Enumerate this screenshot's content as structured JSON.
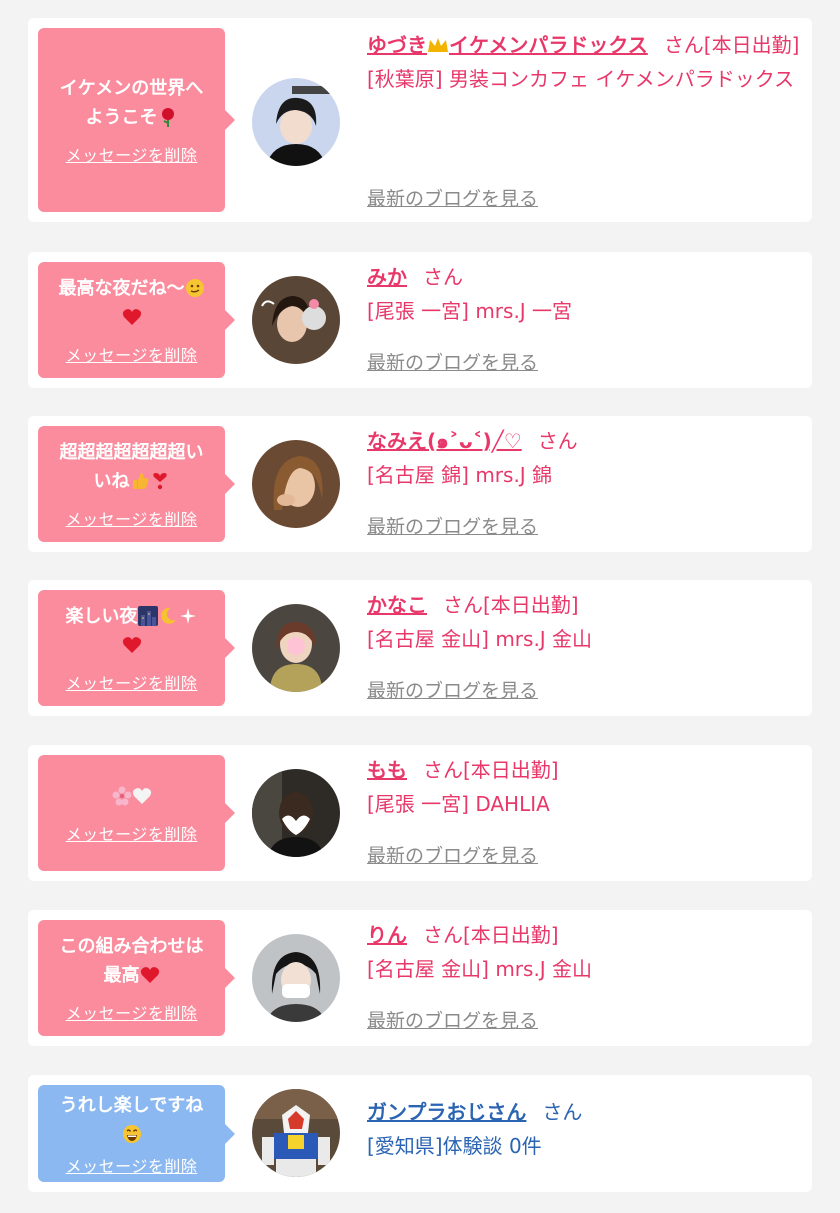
{
  "delete_label": "メッセージを削除",
  "blog_label": "最新のブログを見る",
  "cards": [
    {
      "message": [
        "イケメンの世界へ",
        "ようこそ"
      ],
      "name": "ゆづき",
      "name_tail": "イケメンパラドックス",
      "suffix": "さん[本日出勤]",
      "shop": "[秋葉原] 男装コンカフェ イケメンパラドックス",
      "avatar_icon": "avatar-photo-icon"
    },
    {
      "message": [
        "最高な夜だね〜",
        ""
      ],
      "name": "みか",
      "suffix": "さん",
      "shop": "[尾張 一宮] mrs.J 一宮",
      "avatar_icon": "avatar-photo-icon"
    },
    {
      "message": [
        "超超超超超超超い",
        "いね"
      ],
      "name": "なみえ(๑˃ᴗ˂)╱♡",
      "suffix": "さん",
      "shop": "[名古屋 錦] mrs.J 錦",
      "avatar_icon": "avatar-photo-icon"
    },
    {
      "message": [
        "楽しい夜",
        ""
      ],
      "name": "かなこ",
      "suffix": "さん[本日出勤]",
      "shop": "[名古屋 金山] mrs.J 金山",
      "avatar_icon": "avatar-photo-icon"
    },
    {
      "message": [
        "",
        ""
      ],
      "name": "もも",
      "suffix": "さん[本日出勤]",
      "shop": "[尾張 一宮] DAHLIA",
      "avatar_icon": "avatar-photo-icon"
    },
    {
      "message": [
        "この組み合わせは",
        "最高"
      ],
      "name": "りん",
      "suffix": "さん[本日出勤]",
      "shop": "[名古屋 金山] mrs.J 金山",
      "avatar_icon": "avatar-photo-icon"
    },
    {
      "message": [
        "うれし楽しですね",
        ""
      ],
      "name": "ガンプラおじさん",
      "suffix": "さん",
      "shop": "[愛知県]体験談 0件",
      "avatar_icon": "avatar-photo-icon"
    }
  ],
  "colors": {
    "accent_pink": "#e8386a",
    "bubble_pink": "#fa8c9e",
    "bubble_blue": "#8bb8f0",
    "accent_blue": "#2a64b2"
  }
}
